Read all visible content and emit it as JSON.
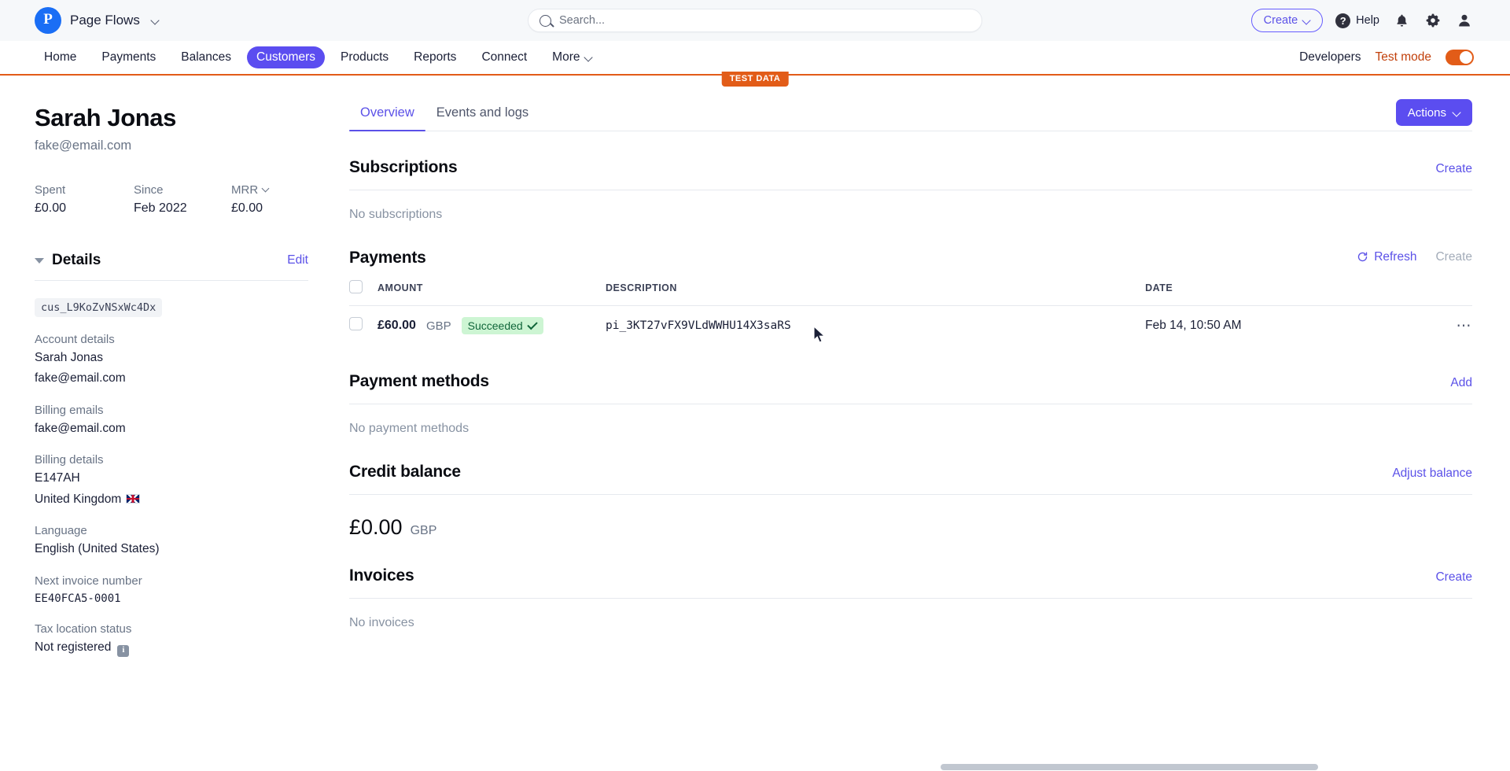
{
  "topbar": {
    "brand_initial": "P",
    "brand_name": "Page Flows",
    "search_placeholder": "Search...",
    "search_value": "",
    "create_label": "Create",
    "help_label": "Help",
    "help_icon": "question-circle-icon",
    "notifications_icon": "bell-icon",
    "settings_icon": "gear-icon",
    "account_icon": "user-icon"
  },
  "nav": {
    "items": [
      {
        "label": "Home",
        "active": false,
        "has_chevron": false
      },
      {
        "label": "Payments",
        "active": false,
        "has_chevron": false
      },
      {
        "label": "Balances",
        "active": false,
        "has_chevron": false
      },
      {
        "label": "Customers",
        "active": true,
        "has_chevron": false
      },
      {
        "label": "Products",
        "active": false,
        "has_chevron": false
      },
      {
        "label": "Reports",
        "active": false,
        "has_chevron": false
      },
      {
        "label": "Connect",
        "active": false,
        "has_chevron": false
      },
      {
        "label": "More",
        "active": false,
        "has_chevron": true
      }
    ],
    "developers_label": "Developers",
    "test_mode_label": "Test mode",
    "test_mode_on": true,
    "test_data_badge": "TEST DATA",
    "accent_orange": "#e25c18",
    "accent_purple": "#5b4df0"
  },
  "sidebar": {
    "customer_name": "Sarah Jonas",
    "customer_email": "fake@email.com",
    "stats": [
      {
        "label": "Spent",
        "value": "£0.00",
        "dotted": true,
        "has_chevron": false
      },
      {
        "label": "Since",
        "value": "Feb 2022",
        "dotted": false,
        "has_chevron": false
      },
      {
        "label": "MRR",
        "value": "£0.00",
        "dotted": false,
        "has_chevron": true
      }
    ],
    "details_title": "Details",
    "edit_label": "Edit",
    "customer_id": "cus_L9KoZvNSxWc4Dx",
    "fields": [
      {
        "label": "Account details",
        "lines": [
          "Sarah Jonas",
          "fake@email.com"
        ],
        "mono": false
      },
      {
        "label": "Billing emails",
        "lines": [
          "fake@email.com"
        ],
        "mono": false
      },
      {
        "label": "Billing details",
        "lines": [
          "E147AH",
          "United Kingdom"
        ],
        "mono": false,
        "flag": true
      },
      {
        "label": "Language",
        "lines": [
          "English (United States)"
        ],
        "mono": false
      },
      {
        "label": "Next invoice number",
        "lines": [
          "EE40FCA5-0001"
        ],
        "mono": true
      },
      {
        "label": "Tax location status",
        "lines": [
          "Not registered"
        ],
        "mono": false,
        "info": true
      }
    ]
  },
  "main": {
    "tabs": [
      {
        "label": "Overview",
        "active": true
      },
      {
        "label": "Events and logs",
        "active": false
      }
    ],
    "actions_button": "Actions",
    "subscriptions": {
      "title": "Subscriptions",
      "create_label": "Create",
      "empty": "No subscriptions"
    },
    "payments": {
      "title": "Payments",
      "refresh_label": "Refresh",
      "refresh_icon": "refresh-icon",
      "create_label": "Create",
      "columns": [
        "AMOUNT",
        "DESCRIPTION",
        "DATE"
      ],
      "rows": [
        {
          "amount": "£60.00",
          "currency": "GBP",
          "status": "Succeeded",
          "description": "pi_3KT27vFX9VLdWWHU14X3saRS",
          "date": "Feb 14, 10:50 AM"
        }
      ]
    },
    "payment_methods": {
      "title": "Payment methods",
      "add_label": "Add",
      "empty": "No payment methods"
    },
    "credit_balance": {
      "title": "Credit balance",
      "adjust_label": "Adjust balance",
      "amount": "£0.00",
      "currency": "GBP"
    },
    "invoices": {
      "title": "Invoices",
      "create_label": "Create",
      "empty": "No invoices"
    }
  }
}
